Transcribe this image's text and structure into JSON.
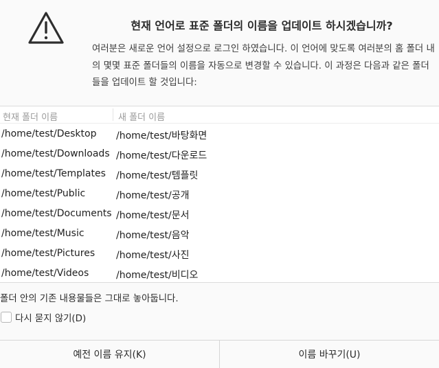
{
  "dialog": {
    "title": "현재 언어로 표준 폴더의 이름을 업데이트 하시겠습니까?",
    "description": "여러분은 새로운 언어 설정으로 로그인 하였습니다. 이 언어에 맞도록 여러분의 홈 폴더 내의 몇몇 표준 폴더들의 이름을 자동으로 변경할 수 있습니다. 이 과정은 다음과 같은 폴더들을 업데이트 할 것입니다:",
    "icon": "warning-triangle-icon"
  },
  "table": {
    "headers": {
      "current": "현재 폴더 이름",
      "new": "새 폴더 이름"
    },
    "rows": [
      {
        "current": "/home/test/Desktop",
        "new": "/home/test/바탕화면"
      },
      {
        "current": "/home/test/Downloads",
        "new": "/home/test/다운로드"
      },
      {
        "current": "/home/test/Templates",
        "new": "/home/test/템플릿"
      },
      {
        "current": "/home/test/Public",
        "new": "/home/test/공개"
      },
      {
        "current": "/home/test/Documents",
        "new": "/home/test/문서"
      },
      {
        "current": "/home/test/Music",
        "new": "/home/test/음악"
      },
      {
        "current": "/home/test/Pictures",
        "new": "/home/test/사진"
      },
      {
        "current": "/home/test/Videos",
        "new": "/home/test/비디오"
      }
    ]
  },
  "note": "폴더 안의 기존 내용물들은 그대로 놓아둡니다.",
  "checkbox": {
    "label": "다시 묻지 않기(D)",
    "checked": false
  },
  "buttons": {
    "keep": "예전 이름 유지(K)",
    "rename": "이름 바꾸기(U)"
  }
}
